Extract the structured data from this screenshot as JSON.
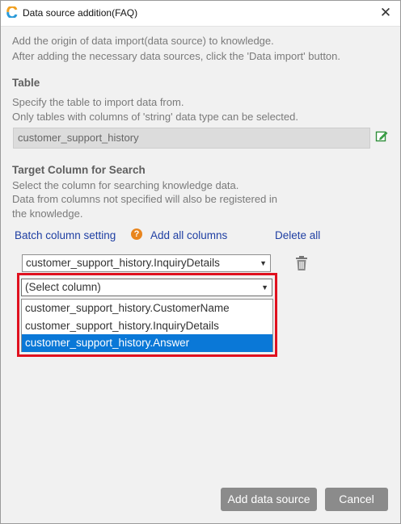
{
  "window": {
    "title": "Data source addition(FAQ)",
    "close_symbol": "✕"
  },
  "intro": {
    "line1": "Add the origin of data import(data source) to knowledge.",
    "line2": "After adding the necessary data sources, click the 'Data import' button."
  },
  "table_section": {
    "heading": "Table",
    "desc_line1": "Specify the table to import data from.",
    "desc_line2": "Only tables with columns of 'string' data type can be selected.",
    "value": "customer_support_history"
  },
  "target_section": {
    "heading": "Target Column for Search",
    "desc_line1": "Select the column for searching knowledge data.",
    "desc_line2": "Data from columns not specified will also be registered in",
    "desc_line3": "the knowledge."
  },
  "links": {
    "batch_setting": "Batch column setting",
    "help": "?",
    "add_all": "Add all columns",
    "delete_all": "Delete all"
  },
  "column_rows": [
    {
      "value": "customer_support_history.InquiryDetails"
    }
  ],
  "new_column_select": {
    "value": "(Select column)",
    "options": [
      {
        "label": "customer_support_history.CustomerName",
        "selected": false
      },
      {
        "label": "customer_support_history.InquiryDetails",
        "selected": false
      },
      {
        "label": "customer_support_history.Answer",
        "selected": true
      }
    ]
  },
  "dropdown_arrow": "▼",
  "buttons": {
    "add": "Add data source",
    "cancel": "Cancel"
  },
  "colors": {
    "highlight": "#e0111f",
    "selected": "#0a78d7",
    "link": "#1f3fa3",
    "button": "#8b8b8b"
  }
}
